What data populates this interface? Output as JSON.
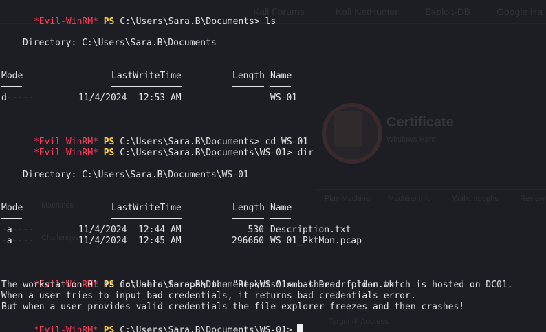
{
  "ghost": {
    "tabs": [
      "Kali Forums",
      "Kali NetHunter",
      "Exploit-DB",
      "Google Ha"
    ],
    "certificate_title": "Certificate",
    "certificate_meta": "Windows   Hard",
    "nav": [
      "Play Machine",
      "Machine Info",
      "Walkthroughs",
      "Review"
    ],
    "sidebar": [
      "Machines",
      "Challenges"
    ],
    "bottom": "Target IP Address"
  },
  "prompt": {
    "name": "*Evil-WinRM*",
    "ps": "PS"
  },
  "session": {
    "cmd1": "C:\\Users\\Sara.B\\Documents> ls",
    "dir1": "Directory: C:\\Users\\Sara.B\\Documents",
    "headers": {
      "mode": "Mode",
      "lastwrite": "LastWriteTime",
      "length": "Length",
      "name": "Name"
    },
    "listing1": [
      {
        "mode": "d-----",
        "date": "11/4/2024",
        "time": "12:53 AM",
        "length": "",
        "name": "WS-01"
      }
    ],
    "cmd2": "C:\\Users\\Sara.B\\Documents> cd WS-01",
    "cmd3": "C:\\Users\\Sara.B\\Documents\\WS-01> dir",
    "dir2": "Directory: C:\\Users\\Sara.B\\Documents\\WS-01",
    "listing2": [
      {
        "mode": "-a----",
        "date": "11/4/2024",
        "time": "12:44 AM",
        "length": "530",
        "name": "Description.txt"
      },
      {
        "mode": "-a----",
        "date": "11/4/2024",
        "time": "12:45 AM",
        "length": "296660",
        "name": "WS-01_PktMon.pcap"
      }
    ],
    "cmd4": "C:\\Users\\Sara.B\\Documents\\WS-01> cat Description.txt",
    "output": [
      "The workstation 01 is not able to open the \"Reports\" smb shared folder which is hosted on DC01.",
      "When a user tries to input bad credentials, it returns bad credentials error.",
      "But when a user provides valid credentials the file explorer freezes and then crashes!"
    ],
    "cmd5": "C:\\Users\\Sara.B\\Documents\\WS-01>"
  },
  "colors": {
    "background": "#1c1e23",
    "prompt_name": "#ff3c5a",
    "prompt_ps": "#ffd23c",
    "text": "#e4e4e4"
  }
}
